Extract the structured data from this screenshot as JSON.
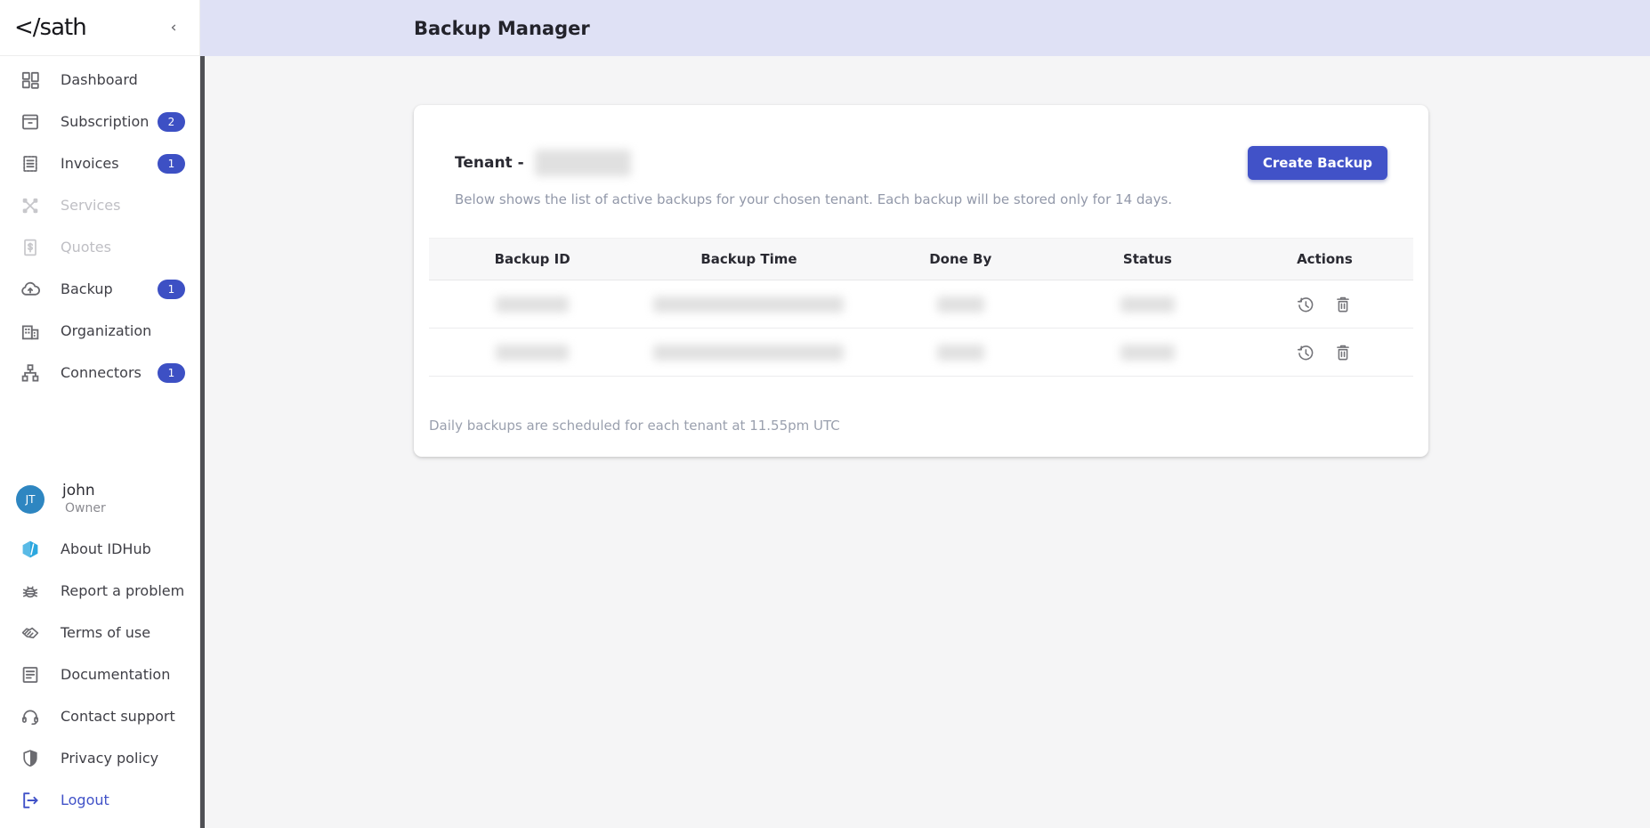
{
  "brand": {
    "logo_text": "</sath"
  },
  "topbar": {
    "title": "Backup Manager"
  },
  "sidebar": {
    "items": [
      {
        "label": "Dashboard",
        "icon": "dashboard-icon",
        "badge": null,
        "disabled": false
      },
      {
        "label": "Subscription",
        "icon": "subscription-icon",
        "badge": "2",
        "disabled": false
      },
      {
        "label": "Invoices",
        "icon": "invoices-icon",
        "badge": "1",
        "disabled": false
      },
      {
        "label": "Services",
        "icon": "services-icon",
        "badge": null,
        "disabled": true
      },
      {
        "label": "Quotes",
        "icon": "quotes-icon",
        "badge": null,
        "disabled": true
      },
      {
        "label": "Backup",
        "icon": "backup-cloud-icon",
        "badge": "1",
        "disabled": false
      },
      {
        "label": "Organization",
        "icon": "organization-icon",
        "badge": null,
        "disabled": false
      },
      {
        "label": "Connectors",
        "icon": "connectors-icon",
        "badge": "1",
        "disabled": false
      }
    ],
    "user": {
      "initials": "JT",
      "name": "john",
      "role": "Owner"
    },
    "footer_items": [
      {
        "label": "About IDHub",
        "icon": "idhub-hexagon-icon"
      },
      {
        "label": "Report a problem",
        "icon": "bug-icon"
      },
      {
        "label": "Terms of use",
        "icon": "handshake-icon"
      },
      {
        "label": "Documentation",
        "icon": "document-icon"
      },
      {
        "label": "Contact support",
        "icon": "headset-icon"
      },
      {
        "label": "Privacy policy",
        "icon": "shield-icon"
      },
      {
        "label": "Logout",
        "icon": "logout-icon"
      }
    ]
  },
  "main": {
    "card": {
      "tenant_label": "Tenant -",
      "tenant_value_redacted": true,
      "description": "Below shows the list of active backups for your chosen tenant. Each backup will be stored only for 14 days.",
      "create_button_label": "Create Backup",
      "table": {
        "columns": [
          "Backup ID",
          "Backup Time",
          "Done By",
          "Status",
          "Actions"
        ],
        "rows": [
          {
            "backup_id_redacted": true,
            "backup_time_redacted": true,
            "done_by_redacted": true,
            "status_redacted": true,
            "actions": [
              "restore",
              "delete"
            ]
          },
          {
            "backup_id_redacted": true,
            "backup_time_redacted": true,
            "done_by_redacted": true,
            "status_redacted": true,
            "actions": [
              "restore",
              "delete"
            ]
          }
        ]
      },
      "footnote": "Daily backups are scheduled for each tenant at 11.55pm UTC"
    }
  },
  "colors": {
    "accent": "#4152C8",
    "badge": "#3D50C4",
    "topbar": "#DFE1F5",
    "avatar": "#2E86C1",
    "idhub_hexagon": "#2BA7DF",
    "page_background": "#f5f5f6"
  }
}
